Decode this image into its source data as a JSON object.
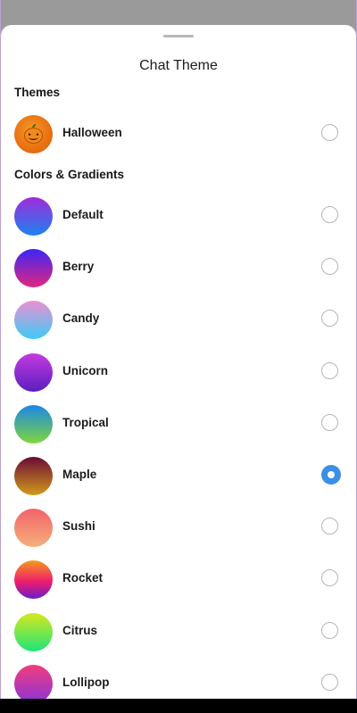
{
  "header": {
    "title": "Chat Theme"
  },
  "sections": {
    "themes": "Themes",
    "colors": "Colors & Gradients"
  },
  "themes": [
    {
      "label": "Halloween",
      "icon": "pumpkin-icon",
      "selected": false
    }
  ],
  "colors": [
    {
      "label": "Default",
      "from": "#a12bd9",
      "to": "#1c82f0",
      "selected": false
    },
    {
      "label": "Berry",
      "from": "#3b25f5",
      "to": "#e42680",
      "selected": false
    },
    {
      "label": "Candy",
      "from": "#ea8fd2",
      "to": "#3dcbf7",
      "selected": false
    },
    {
      "label": "Unicorn",
      "from": "#c53ae0",
      "to": "#5a1fc0",
      "selected": false
    },
    {
      "label": "Tropical",
      "from": "#1c86e8",
      "to": "#7fd63b",
      "selected": false
    },
    {
      "label": "Maple",
      "from": "#6b0b35",
      "to": "#d19a1c",
      "selected": true
    },
    {
      "label": "Sushi",
      "from": "#f2636b",
      "to": "#f5b07a",
      "selected": false
    },
    {
      "label": "Rocket",
      "from": "#f59a1c",
      "to": "#f01d6d",
      "to2": "#6a1cc9",
      "selected": false
    },
    {
      "label": "Citrus",
      "from": "#d7e81c",
      "to": "#1ee47a",
      "selected": false
    },
    {
      "label": "Lollipop",
      "from": "#f23d7b",
      "to": "#8a35d9",
      "selected": false
    }
  ],
  "colors_style": {
    "accent": "#3b8fe6",
    "halloween_orange": "#ec7a14"
  }
}
